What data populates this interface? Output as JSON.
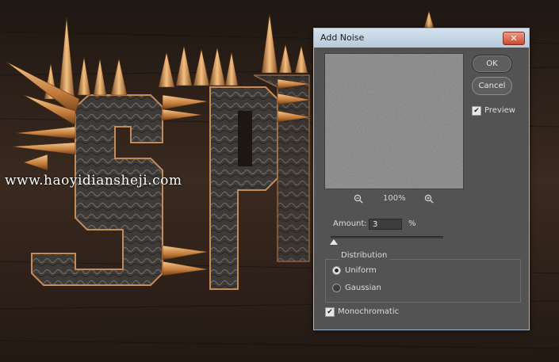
{
  "background": {
    "letters": [
      "S",
      "P"
    ],
    "watermark": "www.haoyidiansheji.com"
  },
  "dialog": {
    "title": "Add Noise",
    "close_icon": "close-icon",
    "preview": {
      "zoom_out_icon": "zoom-out-icon",
      "zoom_level": "100%",
      "zoom_in_icon": "zoom-in-icon"
    },
    "ok_label": "OK",
    "cancel_label": "Cancel",
    "preview_checkbox": {
      "label": "Preview",
      "checked": true
    },
    "amount": {
      "label": "Amount:",
      "value": "3",
      "unit": "%",
      "slider_fraction": 0.008
    },
    "distribution": {
      "title": "Distribution",
      "options": [
        {
          "label": "Uniform",
          "selected": true
        },
        {
          "label": "Gaussian",
          "selected": false
        }
      ]
    },
    "monochromatic": {
      "label": "Monochromatic",
      "checked": true
    }
  },
  "colors": {
    "dialog_bg": "#535353",
    "titlebar": "#c6d6e5",
    "close_button": "#c8472f",
    "spike_gold": "#d8964a",
    "wood": "#2b211b"
  }
}
